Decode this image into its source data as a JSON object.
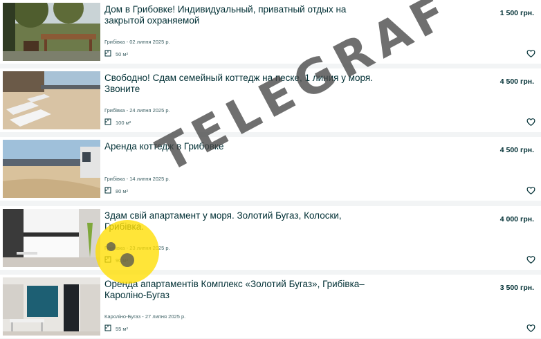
{
  "listings": [
    {
      "title": "Дом в Грибовке! Индивидуальный, приватный отдых на закрытой охраняемой",
      "price": "1 500 грн.",
      "location_date": "Грибівка - 02 липня 2025 р.",
      "area": "50 м²",
      "image": "garden-patio-photo"
    },
    {
      "title": "Свободно! Сдам семейный коттедж на песке, 1 линия у моря. Звоните",
      "price": "4 500 грн.",
      "location_date": "Грибівка - 24 липня 2025 р.",
      "area": "100 м²",
      "image": "beach-sunbeds-photo"
    },
    {
      "title": "Аренда коттедж в Грибовке",
      "price": "4 500 грн.",
      "location_date": "Грибівка - 14 липня 2025 р.",
      "area": "80 м²",
      "image": "beach-fence-photo"
    },
    {
      "title": "Здам свій апартамент у моря. Золотий Бугаз, Колоски, Грибівка.",
      "price": "4 000 грн.",
      "location_date": "Грибівка - 23 липня 2025 р.",
      "area": "90 м²",
      "image": "kitchen-photo"
    },
    {
      "title": "Оренда апартаментів Комплекс «Золотий Бугаз», Грибівка–Кароліно-Бугаз",
      "price": "3 500 грн.",
      "location_date": "Кароліно-Бугаз - 27 липня 2025 р.",
      "area": "55 м²",
      "image": "living-room-photo"
    }
  ],
  "watermark": {
    "text": "TELEGRAF",
    "logo_color": "#ffde00"
  },
  "icons": {
    "area": "floor-plan-icon",
    "favorite": "heart-outline-icon"
  },
  "colors": {
    "title": "#002f34",
    "meta": "#406367",
    "background": "#f2f4f5"
  }
}
